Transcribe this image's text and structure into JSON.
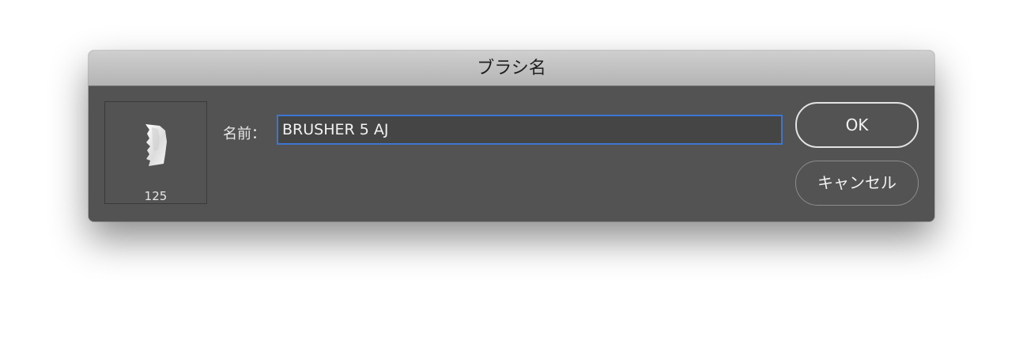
{
  "dialog": {
    "title": "ブラシ名",
    "preview": {
      "icon": "brush-tip-icon",
      "size": "125"
    },
    "name_label": "名前：",
    "name_value": "BRUSHER 5 AJ",
    "ok_label": "OK",
    "cancel_label": "キャンセル"
  },
  "colors": {
    "dialog_bg": "#535353",
    "titlebar": "#c4c4c4",
    "input_focus": "#3c76d2"
  }
}
